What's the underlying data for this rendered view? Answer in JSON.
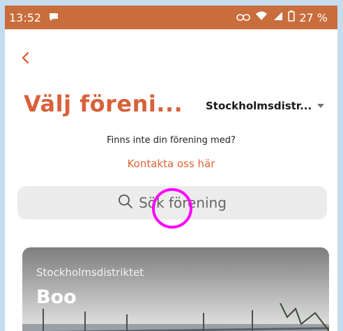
{
  "status_bar": {
    "time": "13:52",
    "battery": "27 %",
    "icons": [
      "chat-icon",
      "link-icon",
      "wifi-icon",
      "signal-icon",
      "battery-icon"
    ]
  },
  "header": {
    "back_icon": "chevron-left-icon",
    "title": "Välj föreni...",
    "district_select": {
      "value": "Stockholmsdistr...",
      "icon": "caret-down-icon"
    }
  },
  "notice": {
    "text": "Finns inte din förening med?",
    "link": "Kontakta oss här"
  },
  "search": {
    "placeholder": "Sök förening",
    "icon": "search-icon"
  },
  "associations": [
    {
      "district": "Stockholmsdistriktet",
      "name": "Boo"
    }
  ],
  "colors": {
    "accent": "#e06434",
    "title": "#d8613b",
    "status_bar": "#c96d3d",
    "annotation": "#ff00ff",
    "search_bg": "#ececec"
  }
}
